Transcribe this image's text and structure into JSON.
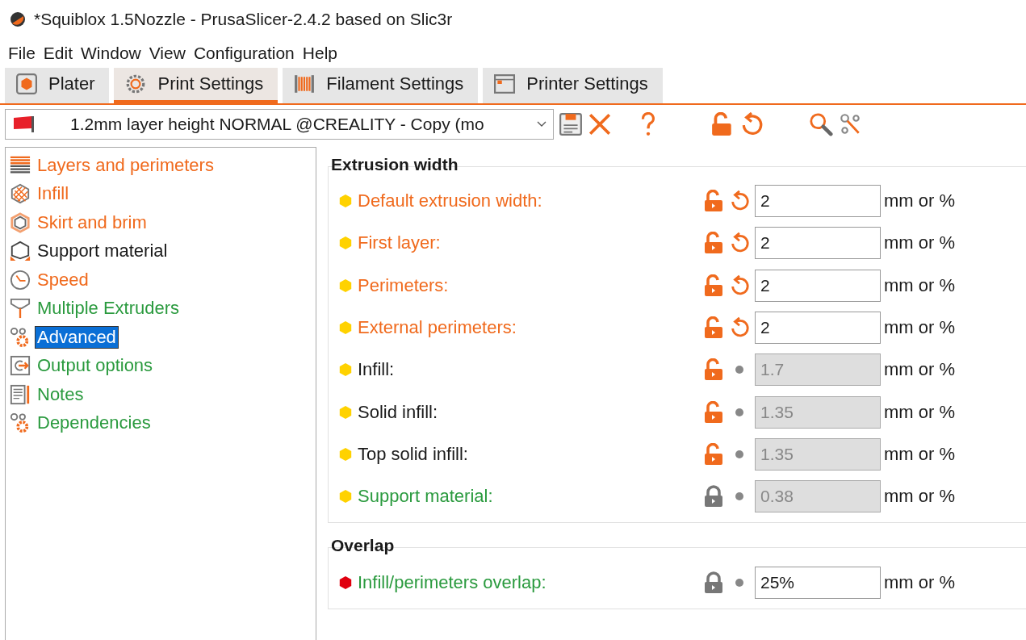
{
  "window": {
    "title": "*Squiblox 1.5Nozzle - PrusaSlicer-2.4.2 based on Slic3r"
  },
  "menu": [
    "File",
    "Edit",
    "Window",
    "View",
    "Configuration",
    "Help"
  ],
  "tabs": [
    {
      "label": "Plater",
      "kind": "plater",
      "selected": false
    },
    {
      "label": "Print Settings",
      "kind": "print",
      "selected": true
    },
    {
      "label": "Filament Settings",
      "kind": "filament",
      "selected": false
    },
    {
      "label": "Printer Settings",
      "kind": "printer",
      "selected": false
    }
  ],
  "preset": {
    "value": "1.2mm layer height NORMAL @CREALITY - Copy (mo"
  },
  "sidebar": {
    "items": [
      {
        "label": "Layers and perimeters",
        "kind": "layers",
        "modified": true,
        "selected": false
      },
      {
        "label": "Infill",
        "kind": "infill",
        "modified": true,
        "selected": false
      },
      {
        "label": "Skirt and brim",
        "kind": "skirt",
        "modified": true,
        "selected": false
      },
      {
        "label": "Support material",
        "kind": "support",
        "modified": false,
        "system": false,
        "selected": false
      },
      {
        "label": "Speed",
        "kind": "speed",
        "modified": true,
        "selected": false
      },
      {
        "label": "Multiple Extruders",
        "kind": "extruders",
        "modified": false,
        "system": true,
        "selected": false
      },
      {
        "label": "Advanced",
        "kind": "gears",
        "selected": true
      },
      {
        "label": "Output options",
        "kind": "output",
        "modified": false,
        "system": true,
        "selected": false
      },
      {
        "label": "Notes",
        "kind": "notes",
        "modified": false,
        "system": true,
        "selected": false
      },
      {
        "label": "Dependencies",
        "kind": "gears",
        "modified": false,
        "system": true,
        "selected": false
      }
    ]
  },
  "groups": [
    {
      "title": "Extrusion width",
      "rows": [
        {
          "label": "Default extrusion width:",
          "modified": true,
          "color": "#ffd200",
          "locked": false,
          "reset": true,
          "disabled": false,
          "value": "2",
          "unit": "mm or %"
        },
        {
          "label": "First layer:",
          "modified": true,
          "color": "#ffd200",
          "locked": false,
          "reset": true,
          "disabled": false,
          "value": "2",
          "unit": "mm or %"
        },
        {
          "label": "Perimeters:",
          "modified": true,
          "color": "#ffd200",
          "locked": false,
          "reset": true,
          "disabled": false,
          "value": "2",
          "unit": "mm or %"
        },
        {
          "label": "External perimeters:",
          "modified": true,
          "color": "#ffd200",
          "locked": false,
          "reset": true,
          "disabled": false,
          "value": "2",
          "unit": "mm or %"
        },
        {
          "label": "Infill:",
          "modified": false,
          "system": false,
          "color": "#ffd200",
          "locked": false,
          "reset": false,
          "disabled": true,
          "value": "1.7",
          "unit": "mm or %"
        },
        {
          "label": "Solid infill:",
          "modified": false,
          "system": false,
          "color": "#ffd200",
          "locked": false,
          "reset": false,
          "disabled": true,
          "value": "1.35",
          "unit": "mm or %"
        },
        {
          "label": "Top solid infill:",
          "modified": false,
          "system": false,
          "color": "#ffd200",
          "locked": false,
          "reset": false,
          "disabled": true,
          "value": "1.35",
          "unit": "mm or %"
        },
        {
          "label": "Support material:",
          "modified": false,
          "system": true,
          "color": "#ffd200",
          "locked": true,
          "reset": false,
          "disabled": true,
          "value": "0.38",
          "unit": "mm or %"
        }
      ]
    },
    {
      "title": "Overlap",
      "rows": [
        {
          "label": "Infill/perimeters overlap:",
          "modified": false,
          "system": true,
          "color": "#e0000f",
          "locked": true,
          "reset": false,
          "disabled": false,
          "value": "25%",
          "unit": "mm or %"
        }
      ]
    }
  ]
}
